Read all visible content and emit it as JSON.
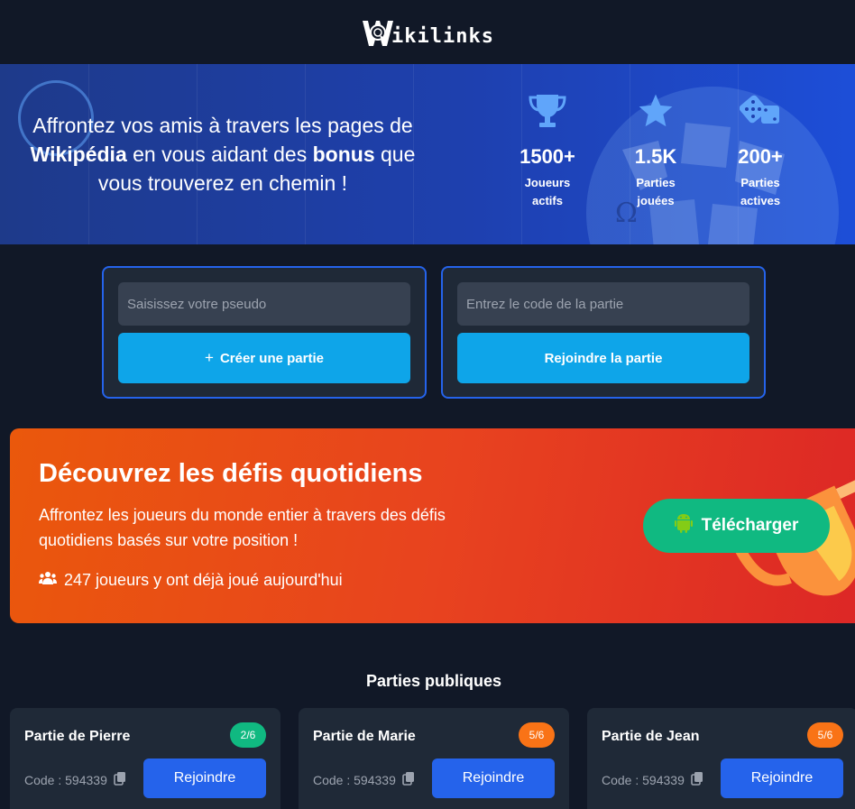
{
  "header": {
    "logo_text": "ikilinks"
  },
  "hero": {
    "text_part1": "Affrontez vos amis à travers les pages de ",
    "text_bold1": "Wikipédia",
    "text_part2": " en vous aidant des ",
    "text_bold2": "bonus",
    "text_part3": " que vous trouverez en chemin !",
    "stats": [
      {
        "icon": "trophy-icon",
        "value": "1500+",
        "label_line1": "Joueurs",
        "label_line2": "actifs"
      },
      {
        "icon": "star-icon",
        "value": "1.5K",
        "label_line1": "Parties",
        "label_line2": "jouées"
      },
      {
        "icon": "dice-icon",
        "value": "200+",
        "label_line1": "Parties",
        "label_line2": "actives"
      }
    ]
  },
  "create": {
    "placeholder": "Saisissez votre pseudo",
    "button_label": "Créer une partie",
    "button_prefix": "+"
  },
  "join": {
    "placeholder": "Entrez le code de la partie",
    "button_label": "Rejoindre la partie"
  },
  "banner": {
    "title": "Découvrez les défis quotidiens",
    "description": "Affrontez les joueurs du monde entier à travers des défis quotidiens basés sur votre position !",
    "players_text": "247 joueurs y ont déjà joué aujourd'hui",
    "download_label": "Télécharger"
  },
  "public_games": {
    "title": "Parties publiques",
    "games": [
      {
        "name": "Partie de Pierre",
        "badge": "2/6",
        "badge_color": "#10b981",
        "code": "Code : 594339",
        "join_label": "Rejoindre"
      },
      {
        "name": "Partie de Marie",
        "badge": "5/6",
        "badge_color": "#f97316",
        "code": "Code : 594339",
        "join_label": "Rejoindre"
      },
      {
        "name": "Partie de Jean",
        "badge": "5/6",
        "badge_color": "#f97316",
        "code": "Code : 594339",
        "join_label": "Rejoindre"
      }
    ]
  },
  "colors": {
    "background": "#111827",
    "accent_blue": "#2563eb",
    "cta_cyan": "#0ea5e9",
    "success_green": "#10b981",
    "warning_orange": "#f97316"
  }
}
